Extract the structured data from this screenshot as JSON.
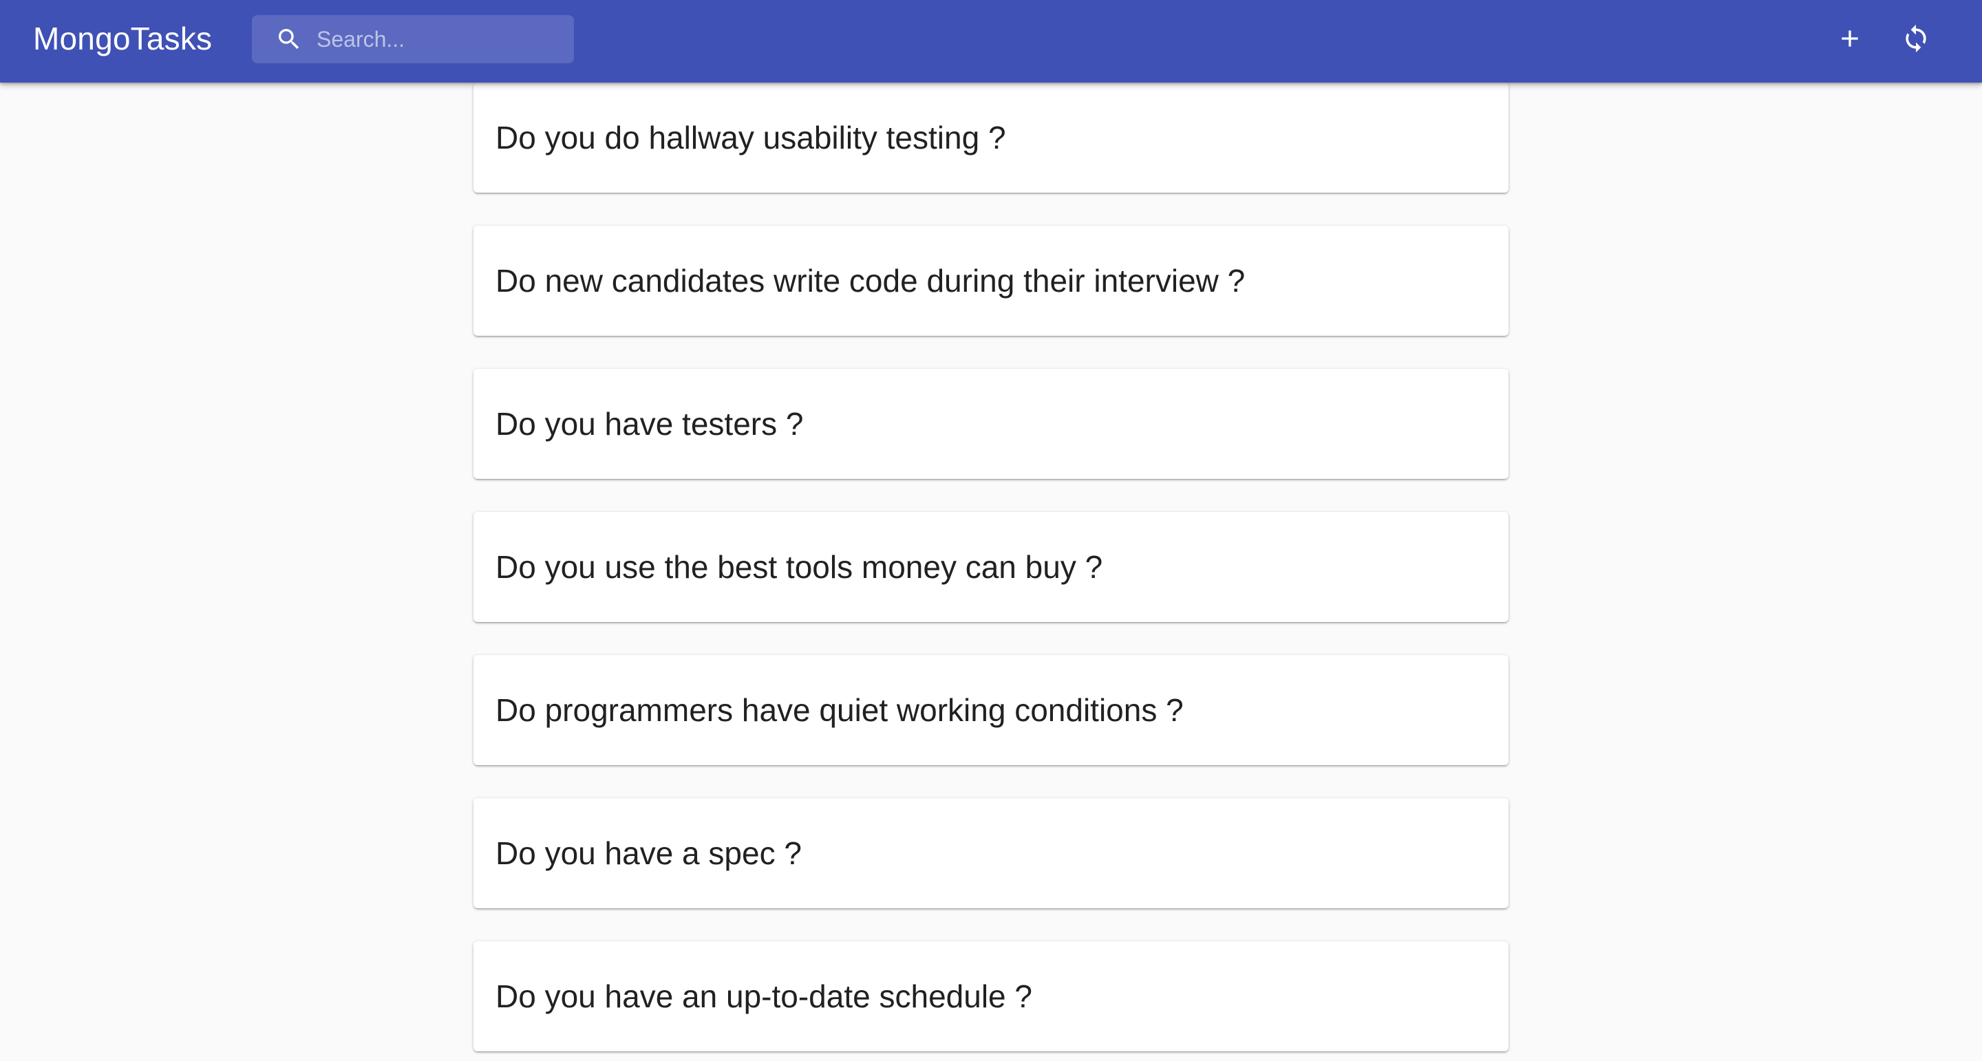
{
  "app": {
    "title": "MongoTasks",
    "accent_color": "#3f51b5"
  },
  "search": {
    "placeholder": "Search...",
    "value": "",
    "icon": "search-icon"
  },
  "toolbar": {
    "add_icon": "plus-icon",
    "refresh_icon": "refresh-icon"
  },
  "tasks": [
    {
      "text": "Do you do hallway usability testing ?"
    },
    {
      "text": "Do new candidates write code during their interview ?"
    },
    {
      "text": "Do you have testers ?"
    },
    {
      "text": "Do you use the best tools money can buy ?"
    },
    {
      "text": "Do programmers have quiet working conditions ?"
    },
    {
      "text": "Do you have a spec ?"
    },
    {
      "text": "Do you have an up-to-date schedule ?"
    }
  ]
}
